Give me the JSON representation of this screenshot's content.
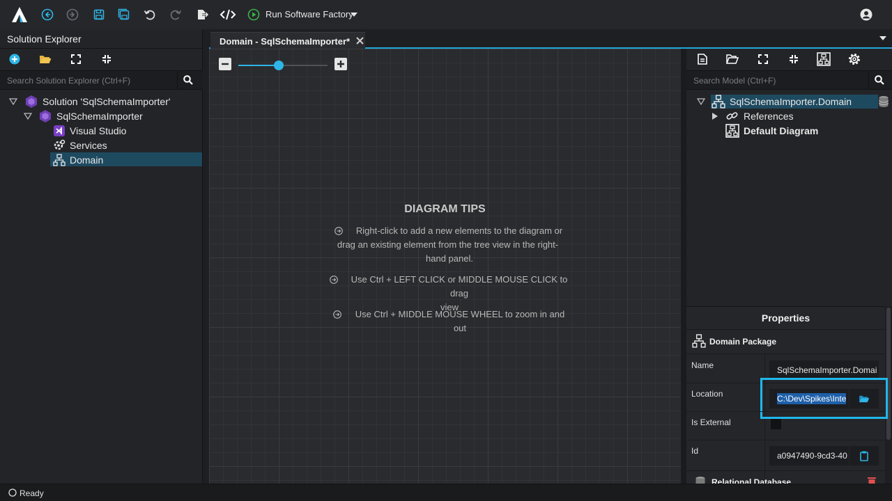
{
  "toolbar": {
    "run_label": "Run Software Factory",
    "icons": [
      "logo-icon",
      "back-icon",
      "forward-icon",
      "save-icon",
      "save-all-icon",
      "undo-icon",
      "redo-icon",
      "export-icon",
      "code-icon",
      "run-icon",
      "dropdown-icon",
      "account-icon"
    ]
  },
  "left_panel": {
    "title": "Solution Explorer",
    "search_placeholder": "Search Solution Explorer (Ctrl+F)",
    "tree": {
      "solution": "Solution 'SqlSchemaImporter'",
      "project": "SqlSchemaImporter",
      "items": [
        "Visual Studio",
        "Services",
        "Domain"
      ]
    }
  },
  "editor": {
    "tab_label": "Domain - SqlSchemaImporter*",
    "zoom": 0.45,
    "tips": {
      "title": "DIAGRAM TIPS",
      "lines": [
        "Right-click to add a new elements to the diagram or drag an existing element from the tree view in the right-hand panel.",
        "Use Ctrl + LEFT CLICK or MIDDLE MOUSE CLICK to drag view",
        "Use Ctrl + MIDDLE MOUSE WHEEL to zoom in and out"
      ],
      "line1a": "Right-click to add a new elements to the diagram or",
      "line1b": "drag an existing element from the tree view in the right-",
      "line1c": "hand panel.",
      "line2a": "Use Ctrl + LEFT CLICK or MIDDLE MOUSE CLICK to drag",
      "line2b": "view",
      "line3a": "Use Ctrl + MIDDLE MOUSE WHEEL to zoom in and out"
    }
  },
  "right_panel": {
    "search_placeholder": "Search Model (Ctrl+F)",
    "tree": {
      "root": "SqlSchemaImporter.Domain",
      "references": "References",
      "diagram": "Default Diagram"
    }
  },
  "properties": {
    "title": "Properties",
    "section": "Domain Package",
    "name_label": "Name",
    "name_value": "SqlSchemaImporter.Domai",
    "location_label": "Location",
    "location_value": "C:\\Dev\\Spikes\\Inte",
    "is_external_label": "Is External",
    "is_external_value": false,
    "id_label": "Id",
    "id_value": "a0947490-9cd3-40",
    "next_section": "Relational Database"
  },
  "status": {
    "text": "Ready"
  },
  "colors": {
    "accent": "#1fa8d8",
    "highlight": "#2fb6e8",
    "tree_selected": "#1e4a60",
    "run_green": "#38b24a"
  }
}
